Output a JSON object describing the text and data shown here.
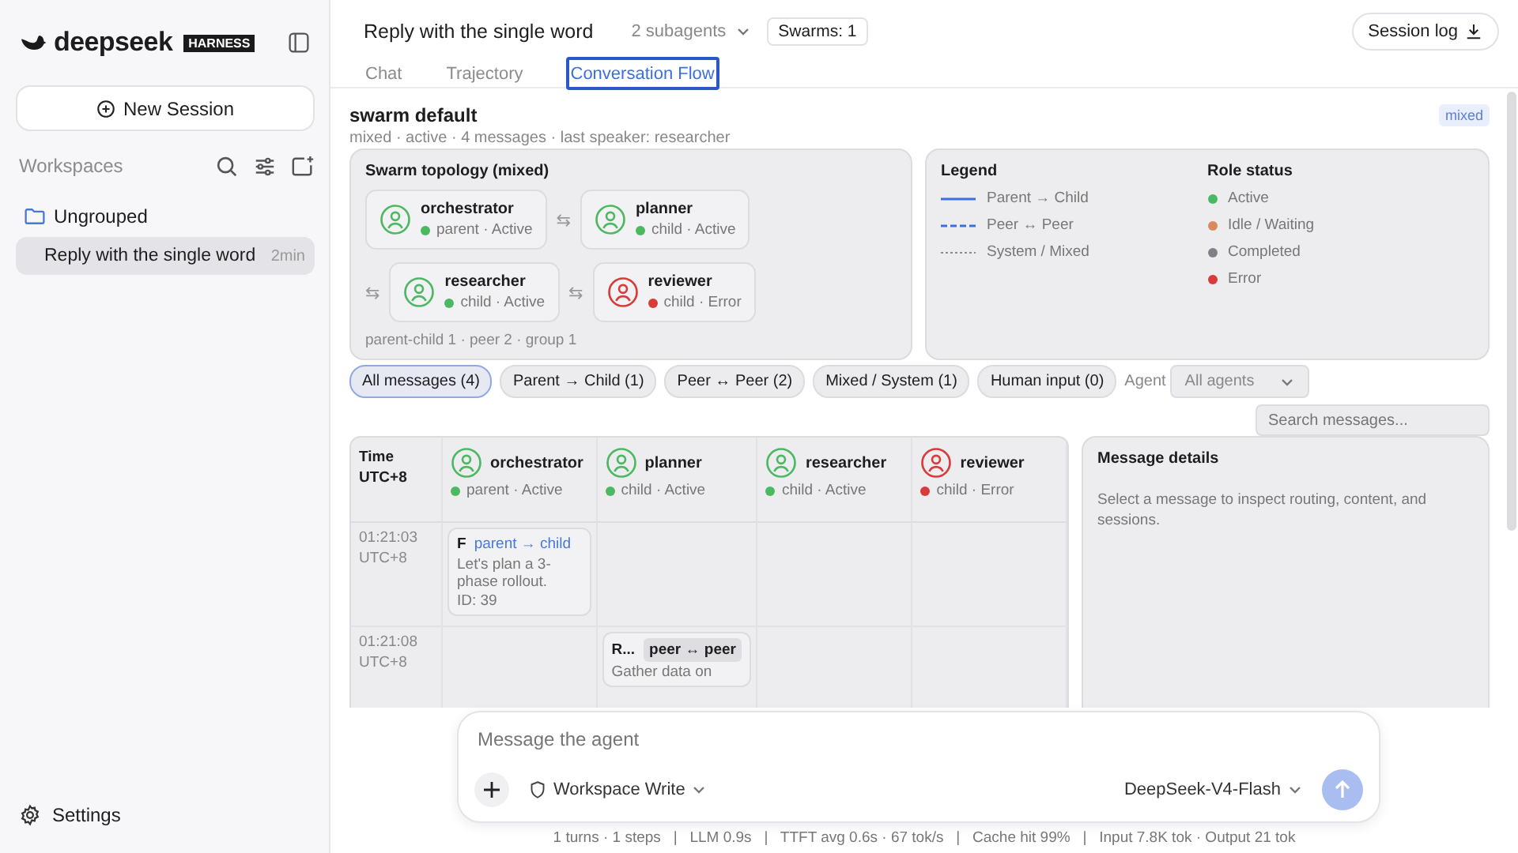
{
  "sidebar": {
    "brand": "deepseek",
    "badge": "HARNESS",
    "new_session": "New Session",
    "workspaces_label": "Workspaces",
    "groups": [
      {
        "name": "Ungrouped",
        "sessions": [
          {
            "title": "Reply with the single word",
            "time": "2min",
            "selected": true
          }
        ]
      }
    ],
    "settings": "Settings"
  },
  "header": {
    "title": "Reply with the single word",
    "subagents": "2 subagents",
    "swarms": "Swarms: 1",
    "session_log": "Session log",
    "tabs": [
      {
        "label": "Chat",
        "selected": false
      },
      {
        "label": "Trajectory",
        "selected": false
      },
      {
        "label": "Conversation Flow",
        "selected": true
      }
    ]
  },
  "swarm": {
    "name": "swarm default",
    "meta": "mixed · active · 4 messages · last speaker: researcher",
    "badge": "mixed"
  },
  "topology": {
    "title": "Swarm topology (mixed)",
    "summary": "parent-child 1 · peer 2 · group 1",
    "links": [
      "⇆",
      "⇆",
      "⇆"
    ],
    "nodes": [
      {
        "name": "orchestrator",
        "status": "parent · Active",
        "color": "#4cb862"
      },
      {
        "name": "planner",
        "status": "child · Active",
        "color": "#4cb862"
      },
      {
        "name": "researcher",
        "status": "child · Active",
        "color": "#4cb862"
      },
      {
        "name": "reviewer",
        "status": "child · Error",
        "color": "#d93a3a"
      }
    ]
  },
  "legend": {
    "title": "Legend",
    "lines": [
      {
        "label": "Parent → Child",
        "kind": "solid"
      },
      {
        "label": "Peer ↔ Peer",
        "kind": "dashed"
      },
      {
        "label": "System / Mixed",
        "kind": "dotted"
      }
    ],
    "status_title": "Role status",
    "statuses": [
      {
        "label": "Active",
        "color": "#4cb862"
      },
      {
        "label": "Idle / Waiting",
        "color": "#d98a5a"
      },
      {
        "label": "Completed",
        "color": "#808086"
      },
      {
        "label": "Error",
        "color": "#d93a3a"
      }
    ]
  },
  "filters": [
    {
      "label": "All messages (4)",
      "selected": true
    },
    {
      "label": "Parent → Child (1)",
      "selected": false
    },
    {
      "label": "Peer ↔ Peer (2)",
      "selected": false
    },
    {
      "label": "Mixed / System (1)",
      "selected": false
    },
    {
      "label": "Human input (0)",
      "selected": false
    }
  ],
  "agent_label": "Agent",
  "agent_select": "All agents",
  "search": {
    "placeholder": "Search messages..."
  },
  "table": {
    "time_header": "Time",
    "tz_header": "UTC+8",
    "columns": [
      {
        "name": "orchestrator",
        "status": "parent · Active",
        "color": "#4cb862"
      },
      {
        "name": "planner",
        "status": "child · Active",
        "color": "#4cb862"
      },
      {
        "name": "researcher",
        "status": "child · Active",
        "color": "#4cb862"
      },
      {
        "name": "reviewer",
        "status": "child · Error",
        "color": "#d93a3a"
      }
    ],
    "rows": [
      {
        "time": "01:21:03",
        "tz": "UTC+8",
        "cells": [
          {
            "sender": "F",
            "tag": "parent → child",
            "kind": "parent-child",
            "body": "Let's plan a 3-phase rollout.",
            "id": "ID: 39"
          },
          null,
          null,
          null
        ]
      },
      {
        "time": "01:21:08",
        "tz": "UTC+8",
        "cells": [
          null,
          {
            "sender": "R...",
            "tag": "peer ↔ peer",
            "kind": "peer",
            "body": "Gather data on"
          },
          null,
          null
        ]
      }
    ]
  },
  "details": {
    "title": "Message details",
    "hint": "Select a message to inspect routing, content, and sessions."
  },
  "composer": {
    "placeholder": "Message the agent",
    "mode": "Workspace Write",
    "model": "DeepSeek-V4-Flash"
  },
  "stats": "1 turns · 1 steps   |   LLM 0.9s   |   TTFT avg 0.6s · 67 tok/s   |   Cache hit 99%   |   Input 7.8K tok · Output 21 tok"
}
